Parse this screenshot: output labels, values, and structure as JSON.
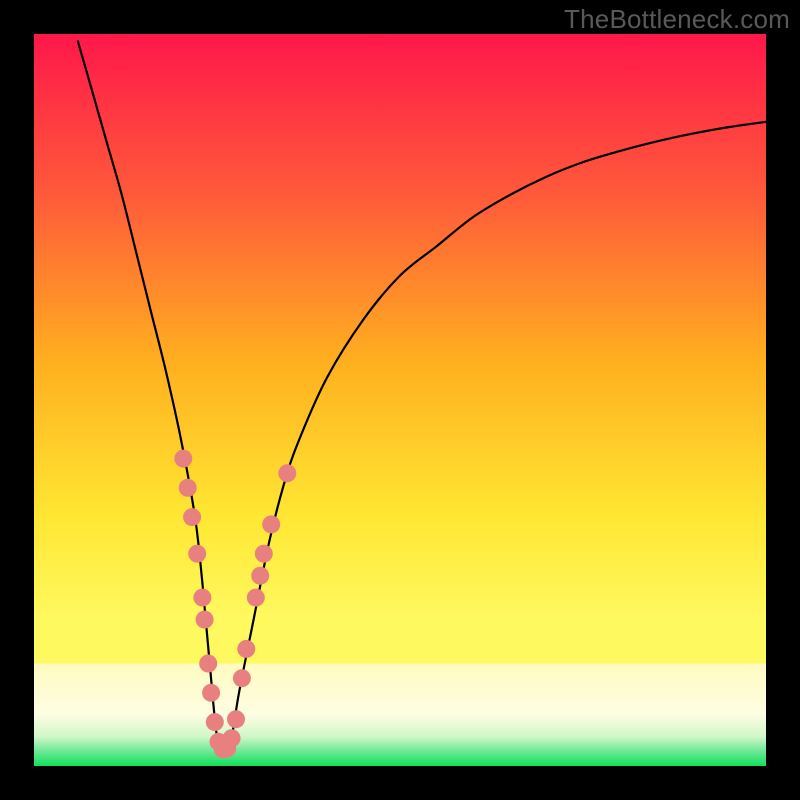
{
  "watermark": "TheBottleneck.com",
  "colors": {
    "frame": "#000000",
    "curve": "#000000",
    "marker_fill": "#e98080",
    "marker_stroke": "#d86a6a",
    "gradient_top": "#ff174a",
    "gradient_mid1": "#ffb01f",
    "gradient_mid2": "#fff960",
    "gradient_band": "#fffab0",
    "gradient_green": "#11e05a"
  },
  "chart_data": {
    "type": "line",
    "title": "",
    "xlabel": "",
    "ylabel": "",
    "xlim": [
      0,
      100
    ],
    "ylim": [
      0,
      100
    ],
    "note": "V-shaped bottleneck curve on a vertical rainbow gradient. Axis ticks/values are not shown in the source image; x/y are normalized 0–100. Lower y = better (green band near bottom).",
    "series": [
      {
        "name": "bottleneck-curve",
        "x": [
          6,
          8,
          10,
          12,
          14,
          16,
          18,
          20,
          22,
          23,
          24,
          25,
          26,
          27,
          28,
          30,
          32,
          34,
          36,
          40,
          45,
          50,
          55,
          60,
          65,
          70,
          75,
          80,
          85,
          90,
          95,
          100
        ],
        "y": [
          99,
          92,
          85,
          78,
          70,
          62,
          54,
          45,
          34,
          25,
          14,
          4,
          2,
          4,
          10,
          20,
          30,
          38,
          44,
          53,
          61,
          67,
          71,
          75,
          78,
          80.5,
          82.5,
          84,
          85.3,
          86.4,
          87.3,
          88
        ]
      }
    ],
    "markers": {
      "name": "sample-points",
      "points": [
        {
          "x": 20.4,
          "y": 42
        },
        {
          "x": 21.0,
          "y": 38
        },
        {
          "x": 21.6,
          "y": 34
        },
        {
          "x": 22.3,
          "y": 29
        },
        {
          "x": 23.0,
          "y": 23
        },
        {
          "x": 23.3,
          "y": 20
        },
        {
          "x": 23.8,
          "y": 14
        },
        {
          "x": 24.2,
          "y": 10
        },
        {
          "x": 24.7,
          "y": 6
        },
        {
          "x": 25.2,
          "y": 3.3
        },
        {
          "x": 25.8,
          "y": 2.3
        },
        {
          "x": 26.4,
          "y": 2.4
        },
        {
          "x": 27.0,
          "y": 3.8
        },
        {
          "x": 27.6,
          "y": 6.4
        },
        {
          "x": 28.4,
          "y": 12
        },
        {
          "x": 29.0,
          "y": 16
        },
        {
          "x": 30.3,
          "y": 23
        },
        {
          "x": 30.9,
          "y": 26
        },
        {
          "x": 31.4,
          "y": 29
        },
        {
          "x": 32.4,
          "y": 33
        },
        {
          "x": 34.6,
          "y": 40
        }
      ]
    }
  }
}
